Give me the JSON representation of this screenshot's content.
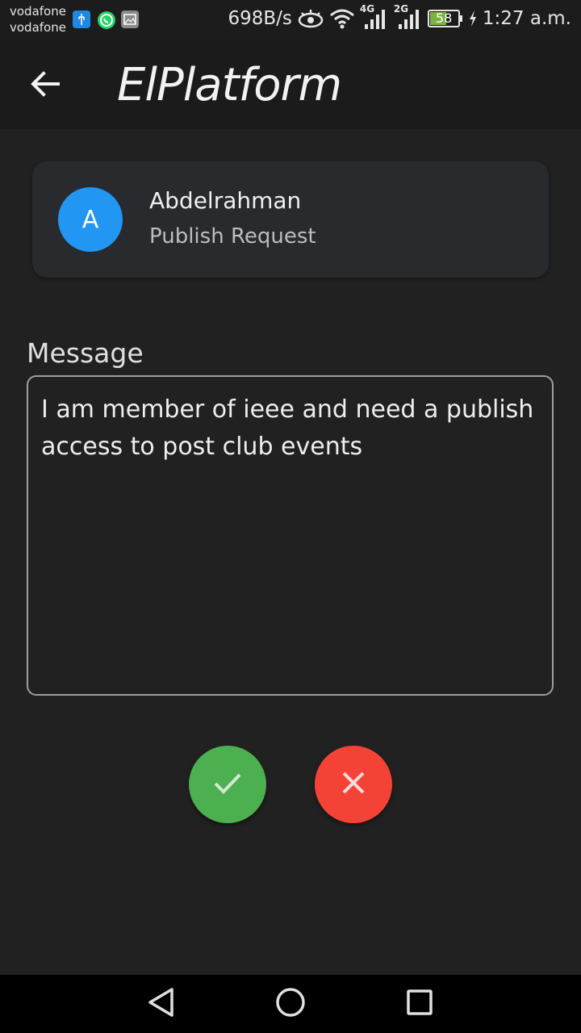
{
  "status_bar": {
    "carrier_1": "vodafone",
    "carrier_2": "vodafone",
    "net_speed": "698B/s",
    "network_1": "4G",
    "network_2": "2G",
    "battery": "58",
    "time": "1:27 a.m.",
    "icons": [
      "usb-icon",
      "whatsapp-icon",
      "gallery-icon",
      "eye-icon",
      "wifi-icon",
      "signal-icon",
      "battery-icon",
      "charging-icon"
    ]
  },
  "app_bar": {
    "title": "ElPlatform",
    "back_icon": "arrow-left-icon"
  },
  "request": {
    "avatar_letter": "A",
    "name": "Abdelrahman",
    "type": "Publish Request"
  },
  "message": {
    "label": "Message",
    "text": "I am member of ieee and need a publish access to post club events"
  },
  "actions": {
    "approve_icon": "check-icon",
    "reject_icon": "close-icon"
  },
  "colors": {
    "background": "#212121",
    "app_bar": "#1b1b1b",
    "card": "#282a2e",
    "avatar": "#2196f3",
    "approve": "#4caf50",
    "reject": "#f44336"
  }
}
